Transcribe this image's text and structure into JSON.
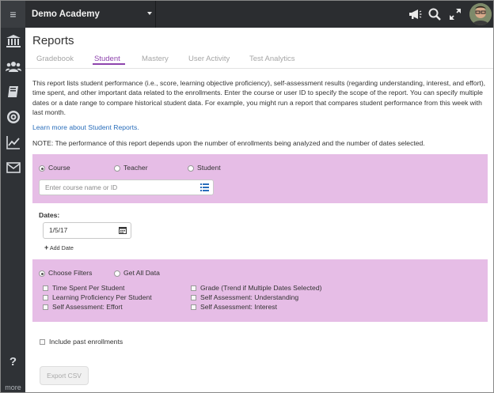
{
  "topbar": {
    "org_name": "Demo Academy"
  },
  "sidebar": {
    "help_label": "?",
    "more_label": "more"
  },
  "page": {
    "title": "Reports"
  },
  "tabs": [
    {
      "label": "Gradebook"
    },
    {
      "label": "Student"
    },
    {
      "label": "Mastery"
    },
    {
      "label": "User Activity"
    },
    {
      "label": "Test Analytics"
    }
  ],
  "active_tab": "Student",
  "description": "This report lists student performance (i.e., score, learning objective proficiency), self-assessment results (regarding understanding, interest, and effort), time spent, and other important data related to the enrollments. Enter the course or user ID to specify the scope of the report. You can specify multiple dates or a date range to compare historical student data. For example, you might run a report that compares student performance from this week with last month.",
  "learn_more": "Learn more about Student Reports.",
  "note": "NOTE: The performance of this report depends upon the number of enrollments being analyzed and the number of dates selected.",
  "scope": {
    "options": [
      "Course",
      "Teacher",
      "Student"
    ],
    "selected": "Course",
    "search_placeholder": "Enter course name or ID"
  },
  "dates": {
    "label": "Dates:",
    "value": "1/5/17",
    "add_label": "Add Date"
  },
  "filters": {
    "modes": [
      "Choose Filters",
      "Get All Data"
    ],
    "selected_mode": "Choose Filters",
    "left": [
      "Time Spent Per Student",
      "Learning Proficiency Per Student",
      "Self Assessment: Effort"
    ],
    "right": [
      "Grade (Trend if Multiple Dates Selected)",
      "Self Assessment: Understanding",
      "Self Assessment: Interest"
    ]
  },
  "include_past": "Include past enrollments",
  "export_label": "Export CSV"
}
